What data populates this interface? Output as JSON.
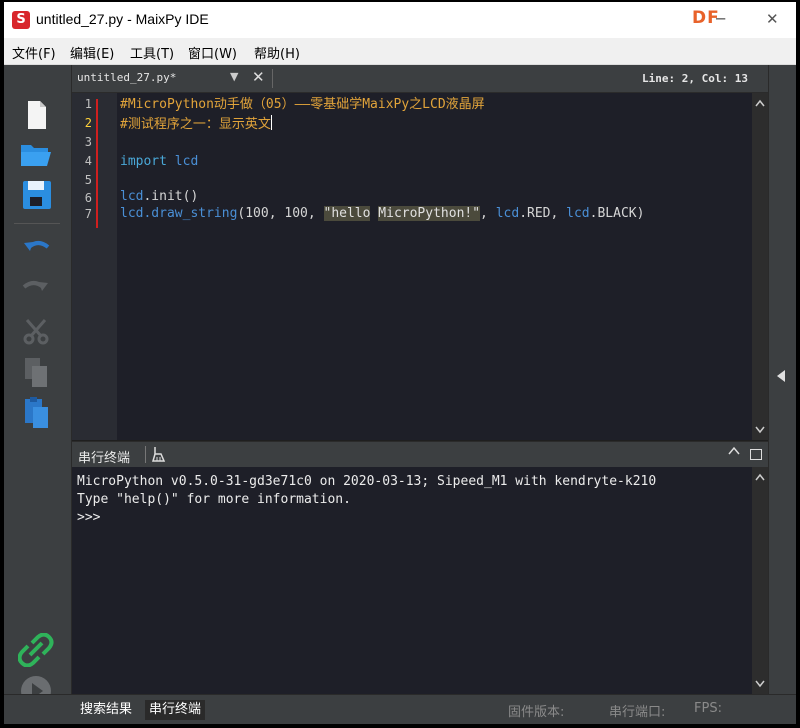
{
  "window": {
    "title": "untitled_27.py - MaixPy IDE",
    "app_icon_letter": "S",
    "watermark": "DF",
    "minimize_glyph": "─",
    "close_glyph": "✕"
  },
  "menu": {
    "items": [
      "文件(F)",
      "编辑(E)",
      "工具(T)",
      "窗口(W)",
      "帮助(H)"
    ]
  },
  "toolbar": {
    "icons": [
      "new-file-icon",
      "open-folder-icon",
      "save-icon",
      "undo-icon",
      "redo-icon",
      "cut-icon",
      "copy-icon",
      "paste-icon",
      "connect-icon",
      "run-icon"
    ]
  },
  "editor": {
    "tab_label": "untitled_27.py*",
    "tab_dropdown": "▼",
    "tab_close": "✕",
    "cursor_position": "Line: 2, Col: 13",
    "line_numbers": [
      "1",
      "2",
      "3",
      "4",
      "5",
      "6",
      "7"
    ],
    "lines": {
      "l1": "#MicroPython动手做（05）——零基础学MaixPy之LCD液晶屏",
      "l2": "#测试程序之一：显示英文",
      "l4_kw": "import",
      "l4_mod": " lcd",
      "l6_mod": "lcd",
      "l6_rest": ".init()",
      "l7_mod": "lcd",
      "l7_fn": ".draw_string",
      "l7_args": "(100, 100, ",
      "l7_str1": "\"hello",
      "l7_space": " ",
      "l7_str2": "MicroPython!\"",
      "l7_comma": ", ",
      "l7_mod2": "lcd",
      "l7_red": ".RED, ",
      "l7_mod3": "lcd",
      "l7_black": ".BLACK)"
    }
  },
  "terminal": {
    "title": "串行终端",
    "lines": [
      "MicroPython v0.5.0-31-gd3e71c0 on 2020-03-13; Sipeed_M1 with kendryte-k210",
      "Type \"help()\" for more information.",
      ">>>"
    ]
  },
  "bottom_bar": {
    "tabs": [
      "搜索结果",
      "串行终端"
    ],
    "firmware_label": "固件版本:",
    "serial_port_label": "串行端口:",
    "fps_label": "FPS:"
  },
  "colors": {
    "comment": "#e2a43a",
    "keyword": "#4aa8d8",
    "module": "#4a8fd6",
    "modified_marker": "#d01f1f",
    "current_line_number": "#ffd23a"
  }
}
